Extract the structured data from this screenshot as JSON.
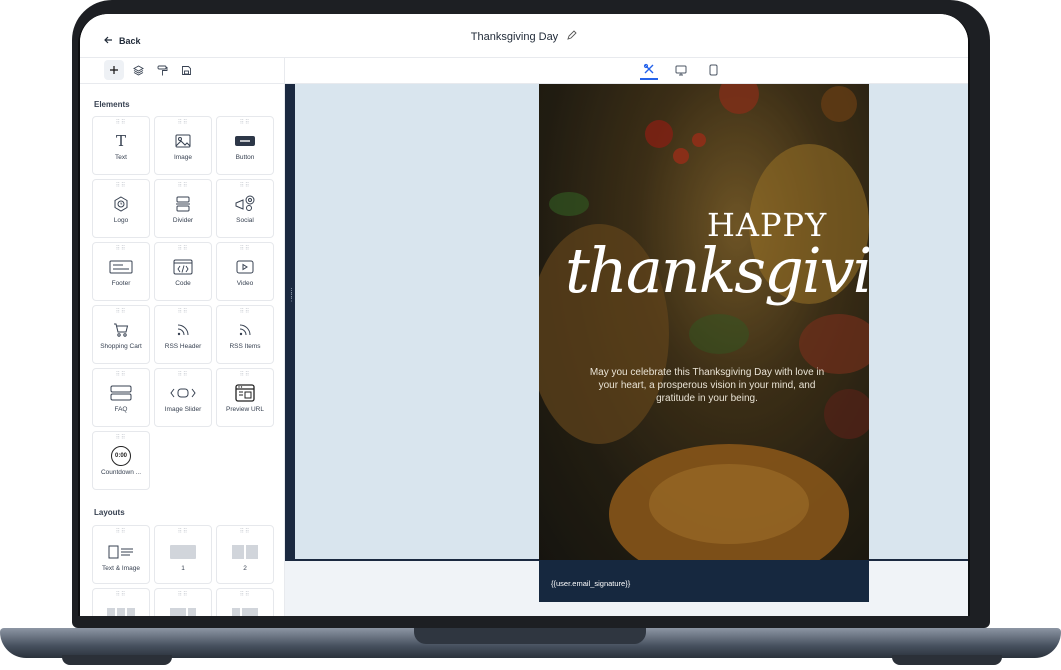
{
  "header": {
    "back_label": "Back",
    "title": "Thanksgiving Day"
  },
  "toolbar": {
    "left_tools": [
      "plus-icon",
      "layers-icon",
      "paint-roller-icon",
      "save-icon"
    ],
    "device_tools": [
      "tools-icon",
      "desktop-icon",
      "mobile-icon"
    ],
    "active_device": "tools-icon"
  },
  "sidebar": {
    "elements_title": "Elements",
    "elements": [
      {
        "label": "Text",
        "icon": "text-icon"
      },
      {
        "label": "Image",
        "icon": "image-icon"
      },
      {
        "label": "Button",
        "icon": "button-icon"
      },
      {
        "label": "Logo",
        "icon": "logo-icon"
      },
      {
        "label": "Divider",
        "icon": "divider-icon"
      },
      {
        "label": "Social",
        "icon": "social-icon"
      },
      {
        "label": "Footer",
        "icon": "footer-icon"
      },
      {
        "label": "Code",
        "icon": "code-icon"
      },
      {
        "label": "Video",
        "icon": "video-icon"
      },
      {
        "label": "Shopping Cart",
        "icon": "cart-icon"
      },
      {
        "label": "RSS Header",
        "icon": "rss-icon"
      },
      {
        "label": "RSS Items",
        "icon": "rss-icon"
      },
      {
        "label": "FAQ",
        "icon": "faq-icon"
      },
      {
        "label": "Image Slider",
        "icon": "slider-icon"
      },
      {
        "label": "Preview URL",
        "icon": "preview-url-icon"
      },
      {
        "label": "Countdown ...",
        "icon": "countdown-icon"
      }
    ],
    "countdown_value": "0:00",
    "layouts_title": "Layouts",
    "layouts": [
      {
        "label": "Text & Image"
      },
      {
        "label": "1"
      },
      {
        "label": "2"
      }
    ]
  },
  "email": {
    "happy": "HAPPY",
    "script": "thanksgiving",
    "message": "May you celebrate this Thanksgiving Day with love in your heart, a prosperous vision in your mind, and gratitude in your being.",
    "signature": "{{user.email_signature}}"
  }
}
